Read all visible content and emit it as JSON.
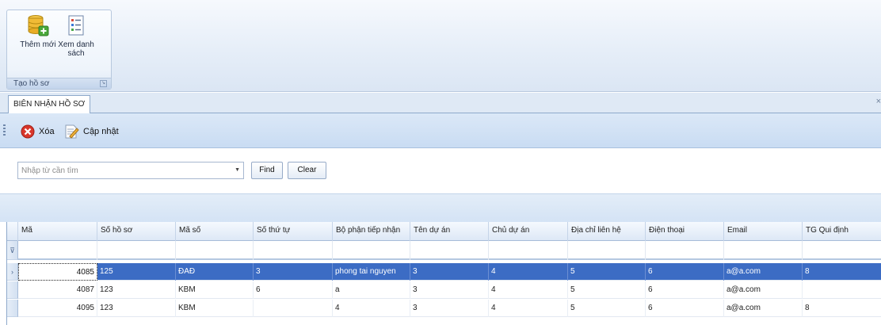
{
  "ribbon": {
    "add_label": "Thêm mới",
    "list_label": "Xem danh sách",
    "group_label": "Tạo hồ sơ"
  },
  "tab": {
    "label": "BIÊN NHẬN HỒ SƠ"
  },
  "toolbar": {
    "delete_label": "Xóa",
    "update_label": "Cập nhật"
  },
  "search": {
    "placeholder": "Nhập từ cần tìm",
    "value": "",
    "find_label": "Find",
    "clear_label": "Clear"
  },
  "grid": {
    "columns": [
      "Mã",
      "Số hồ sơ",
      "Mã số",
      "Số thứ tự",
      "Bộ phận tiếp nhận",
      "Tên dự án",
      "Chủ dự án",
      "Địa chỉ liên hệ",
      "Điện thoại",
      "Email",
      "TG Qui định"
    ],
    "rows": [
      [
        "4085",
        "125",
        "ĐAĐ",
        "3",
        "phong tai nguyen",
        "3",
        "4",
        "5",
        "6",
        "a@a.com",
        "8"
      ],
      [
        "4087",
        "123",
        "KBM",
        "6",
        "a",
        "3",
        "4",
        "5",
        "6",
        "a@a.com",
        ""
      ],
      [
        "4095",
        "123",
        "KBM",
        "",
        "4",
        "3",
        "4",
        "5",
        "6",
        "a@a.com",
        "8"
      ]
    ],
    "selected_row": 0
  },
  "colors": {
    "selection": "#3c6cc4",
    "ribbon": "#dbe6f4",
    "toolbar": "#c9dcf3"
  }
}
